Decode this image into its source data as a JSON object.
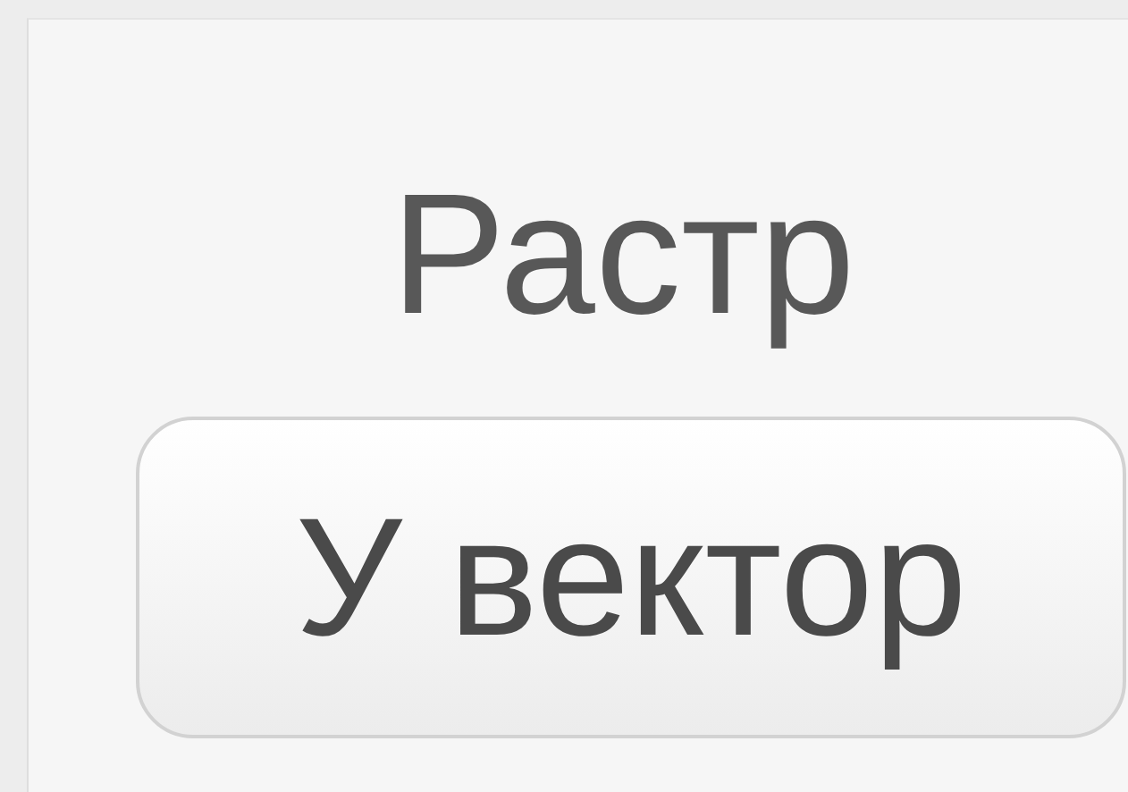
{
  "panel": {
    "title": "Растр",
    "button": {
      "label": "У вектор"
    }
  }
}
